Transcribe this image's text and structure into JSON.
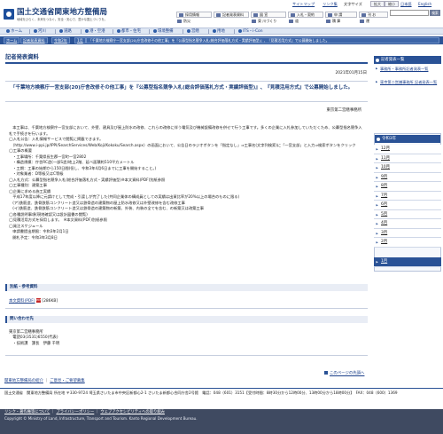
{
  "header": {
    "site_title": "国土交通省関東地方整備局",
    "site_sub": "地域をひらく、未来をつなぐ。安全・安心で、豊かな国土づくりを。",
    "util_links": [
      "サイトマップ",
      "リンク集",
      "文字サイズ",
      "拡大",
      "縮小"
    ],
    "util_buttons": [
      "日本語",
      "English"
    ],
    "search_placeholder": "",
    "search_button": "検索",
    "shortcuts_row1": [
      "採用情報",
      "記者発表資料",
      "図 宣",
      "入札・契約",
      "申 請",
      "刊 お"
    ],
    "shortcuts_row2": [
      "防災",
      "",
      "東 川づくり",
      "道",
      "積 算",
      "運"
    ]
  },
  "nav": {
    "items": [
      "ホーム",
      "河川",
      "道路",
      "港・空港",
      "都市・住宅",
      "環境整備",
      "営繕",
      "用地",
      "ITS・i-Con"
    ]
  },
  "breadcrumb": [
    "ホーム",
    "記者発表資料",
    "令和2年",
    "1月",
    "「千葉地方検察庁一宮支部(20)庁舎改修その他工事」を『公募型指名競争入札(総合評価落札方式・実績評価型)』、『見積活用方式』で公募開始しました。"
  ],
  "main": {
    "page_title": "記者発表資料",
    "date": "2021年01月15日",
    "lead": "「千葉地方検察庁一宮支部(20)庁舎改修その他工事」を『公募型指名競争入札(総合評価落札方式・実績評価型)』、『見積活用方式』で公募開始しました。",
    "office": "東京第二営繕事務所",
    "body": "　本工事は、千葉地方検察庁一宮支部において、外壁、建具及び屋上防水の改修、これらの改修に伴う電気及び機械設備改修を併せて行う工事です。多くの企業に入札参加していただくため、公募型指名競争入札で手続きを行います。\n◯入札公告：入札情報サービスで閲覧に掲載できます。\n　（http://www.i-ppi.jp/IPPI/SearchServices/Web/Koji/Kokoku/Search.aspx）の画面において、公告日のラジオボタンを「指定なし」⇒工事名(文字列検索)に「一宮支部」と入力⇒検索ボタンをクリック\n◯工事の概要\n　・工事場所：千葉県長生郡一宮町一宮2802\n　・構造規模：庁舎RC造(一部S造)地上2階、延べ面積約510平方メートル\n　・工期：工事の始期から150日間(但し、令和3年4月6日までに工事を開始すること。)\n　・対象業者：D等級又はC等級\n◯入札方式：公募型指名競争入札(総合評価落札方式・実績評価型)※本文資料(PDF)別紙参照\n◯工事種別：建築工事\n◯企業に求める施工実績\n　平成17年度以降に元請けとして完成・引渡しが完了した(共同企業体の構成員としての実績は出資比率が20%以上の場合のものに限る)\n　(ア)鉄筋造、鉄骨鉄筋コンクリート造又は鉄骨造の建築物の屋上防水改修又は外壁改修を含む改修工事\n　(イ)鉄筋造、鉄骨鉄筋コンクリート造又は鉄骨造の建築物の新築、外装、内装の全てを含む、の新築又は改築工事\n◯各種説明事項(現地確認又は設計図書の閲覧)\n◯見積活用方式を採用します。　※本文資料(PDF)別紙参照\n◯発注スケジュール\n　申請書提出期限：令和3年2月1日\n　開札予定：令和3年3月8日"
  },
  "reference": {
    "heading": "別紙・参考資料",
    "file_label": "本文資料(PDF)",
    "pdf_badge": "PDF",
    "file_size": "[286KB]"
  },
  "contact": {
    "heading": "問い合わせ先",
    "lines": [
      "東京第二営繕事務所",
      "　電話03(3531)6550(代表)",
      "　・技術課　課長　伊藤 千明"
    ]
  },
  "pagetop": "このページの先頭へ",
  "bottom_links": [
    "関東地方整備局の紹介",
    "ご意見・ご要望募集"
  ],
  "footer": {
    "address": "国土交通省　関東地方整備局 所在地 〒330-9724 埼玉県さいたま市中央区新都心2-1 さいたま新都心合同庁舎2号館　電話：048（601）3151【受付時間：8時30分から12時00分、13時00分から18時00分】　FAX：048（600）1369",
    "links": [
      "リンク・著作権等について",
      "プライバシーポリシー",
      "ウェブアクセシビリティへの取り組み"
    ],
    "copyright": "Copyright © Ministry of Land, Infrastructure, Transport and Tourism. Kanto Regional Development Bureau."
  },
  "sidebar": {
    "heading": "記者発表一覧",
    "links": [
      "事務所・事務所記者発表一覧",
      "東京第二営繕事務所 記者発表一覧"
    ],
    "year_heading": "令和3年",
    "months": [
      "1月",
      "12月",
      "11月",
      "10月",
      "9月",
      "8月",
      "7月",
      "6月",
      "5月",
      "4月",
      "3月",
      "2月",
      "1月"
    ],
    "active_month_index": 12
  }
}
